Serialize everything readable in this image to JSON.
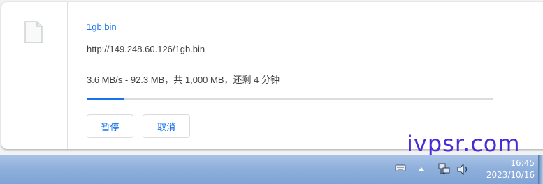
{
  "download": {
    "file_name": "1gb.bin",
    "url": "http://149.248.60.126/1gb.bin",
    "status": "3.6 MB/s - 92.3 MB，共 1,000 MB，还剩 4 分钟",
    "progress_percent": 9.2,
    "pause_label": "暂停",
    "cancel_label": "取消"
  },
  "watermark": "ivpsr.com",
  "taskbar": {
    "time": "16:45",
    "date": "2023/10/16",
    "icons": [
      "keyboard-icon",
      "show-hidden-icons-icon",
      "network-icon",
      "volume-icon"
    ]
  },
  "colors": {
    "accent": "#1a73e8",
    "progress_track": "#dadce0",
    "watermark": "#4a2bd8",
    "taskbar": "#8fb0dc"
  }
}
